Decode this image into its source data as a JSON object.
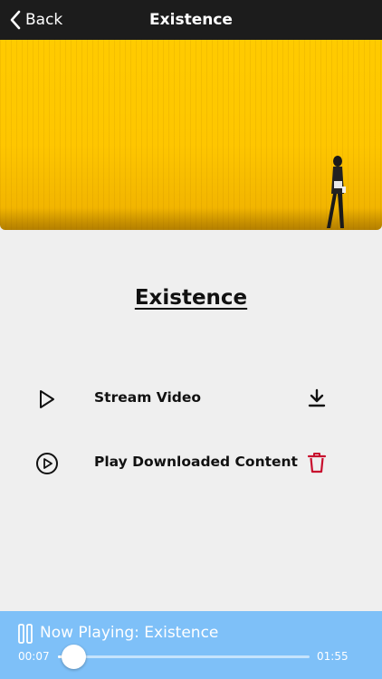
{
  "nav": {
    "back_label": "Back",
    "title": "Existence"
  },
  "hero": {
    "description_icon": "yellow-wall-photo",
    "wall_color": "#ffcb00"
  },
  "content": {
    "title": "Existence",
    "options": [
      {
        "label": "Stream Video",
        "icon": "play-icon",
        "action_icon": "download-icon",
        "action_color": "#111111"
      },
      {
        "label": "Play Downloaded Content",
        "icon": "play-circle-icon",
        "action_icon": "trash-icon",
        "action_color": "#c8102e"
      }
    ]
  },
  "player": {
    "now_playing": "Now Playing: Existence",
    "elapsed": "00:07",
    "total": "01:55",
    "progress": 0.0609,
    "background": "#7ec0f8"
  }
}
